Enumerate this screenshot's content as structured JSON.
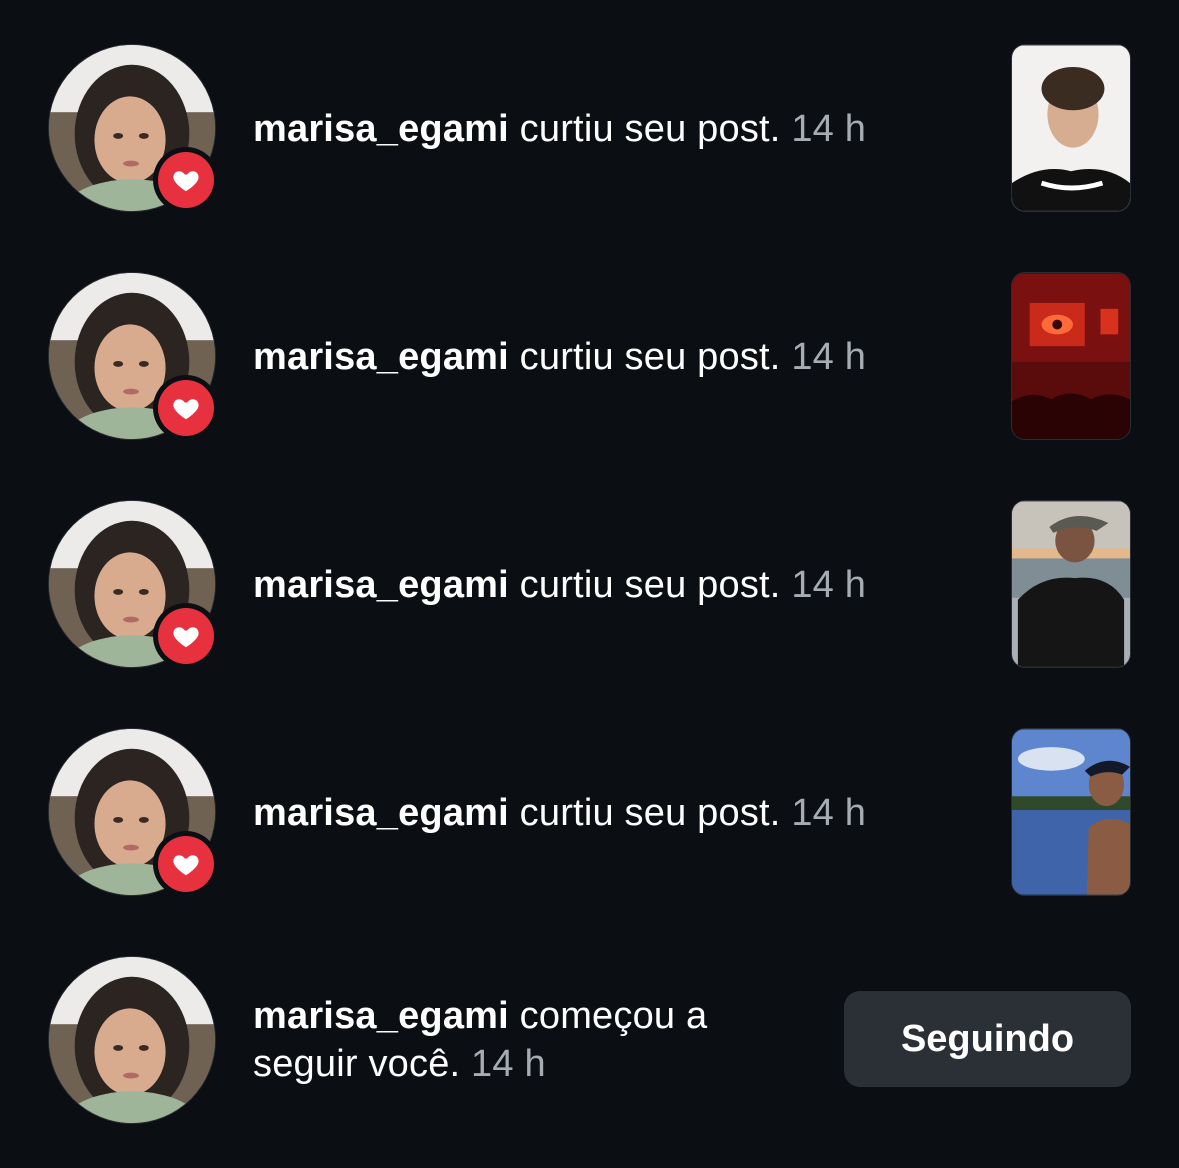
{
  "notifications": [
    {
      "username": "marisa_egami",
      "action": "curtiu seu post.",
      "time": "14 h",
      "badge_icon": "heart-icon",
      "thumbnail": "post-thumbnail-portrait"
    },
    {
      "username": "marisa_egami",
      "action": "curtiu seu post.",
      "time": "14 h",
      "badge_icon": "heart-icon",
      "thumbnail": "post-thumbnail-concert"
    },
    {
      "username": "marisa_egami",
      "action": "curtiu seu post.",
      "time": "14 h",
      "badge_icon": "heart-icon",
      "thumbnail": "post-thumbnail-sunset"
    },
    {
      "username": "marisa_egami",
      "action": "curtiu seu post.",
      "time": "14 h",
      "badge_icon": "heart-icon",
      "thumbnail": "post-thumbnail-lake"
    }
  ],
  "follow_notification": {
    "username": "marisa_egami",
    "action_line1": "começou a",
    "action_line2": "seguir você.",
    "time": "14 h",
    "button_label": "Seguindo"
  },
  "colors": {
    "background": "#0b0f14",
    "like_badge": "#e8313f",
    "time_text": "#a7acb3",
    "button_bg": "#2b2f36"
  }
}
